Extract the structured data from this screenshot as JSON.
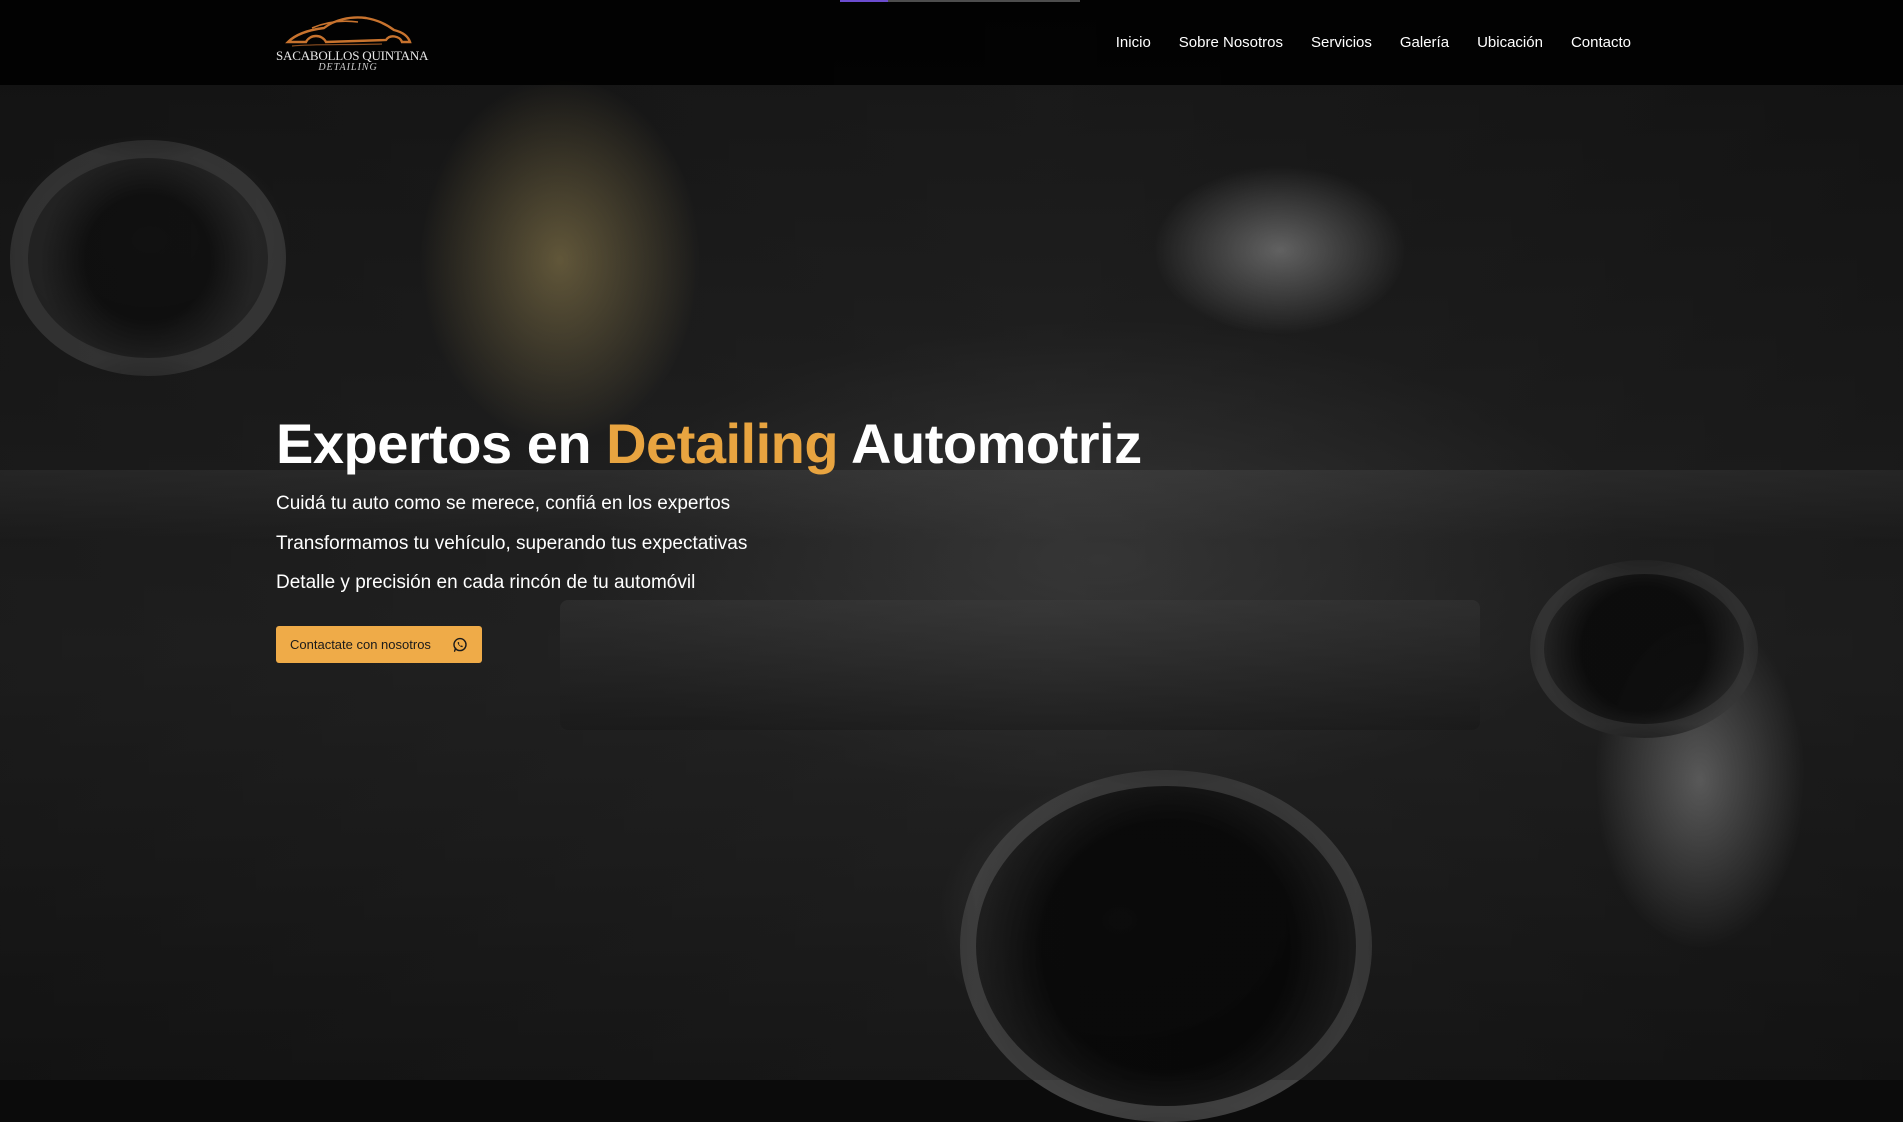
{
  "brand": {
    "name": "SACABOLLOS QUINTANA",
    "sub": "DETAILING",
    "logo_icon": "car-silhouette-icon",
    "logo_color": "#c8732e"
  },
  "nav": {
    "items": [
      {
        "label": "Inicio"
      },
      {
        "label": "Sobre Nosotros"
      },
      {
        "label": "Servicios"
      },
      {
        "label": "Galería"
      },
      {
        "label": "Ubicación"
      },
      {
        "label": "Contacto"
      }
    ]
  },
  "hero": {
    "title_part1": "Expertos en ",
    "title_accent": "Detailing",
    "title_part2": " Automotriz",
    "taglines": [
      "Cuidá tu auto como se merece, confiá en los expertos",
      "Transformamos tu vehículo, superando tus expectativas",
      "Detalle y precisión en cada rincón de tu automóvil"
    ],
    "cta_label": "Contactate con nosotros",
    "cta_icon": "whatsapp-icon"
  },
  "colors": {
    "accent": "#e8a440",
    "button": "#efab48",
    "header_bg": "#000000",
    "top_indicator": "#6b4ccf"
  }
}
